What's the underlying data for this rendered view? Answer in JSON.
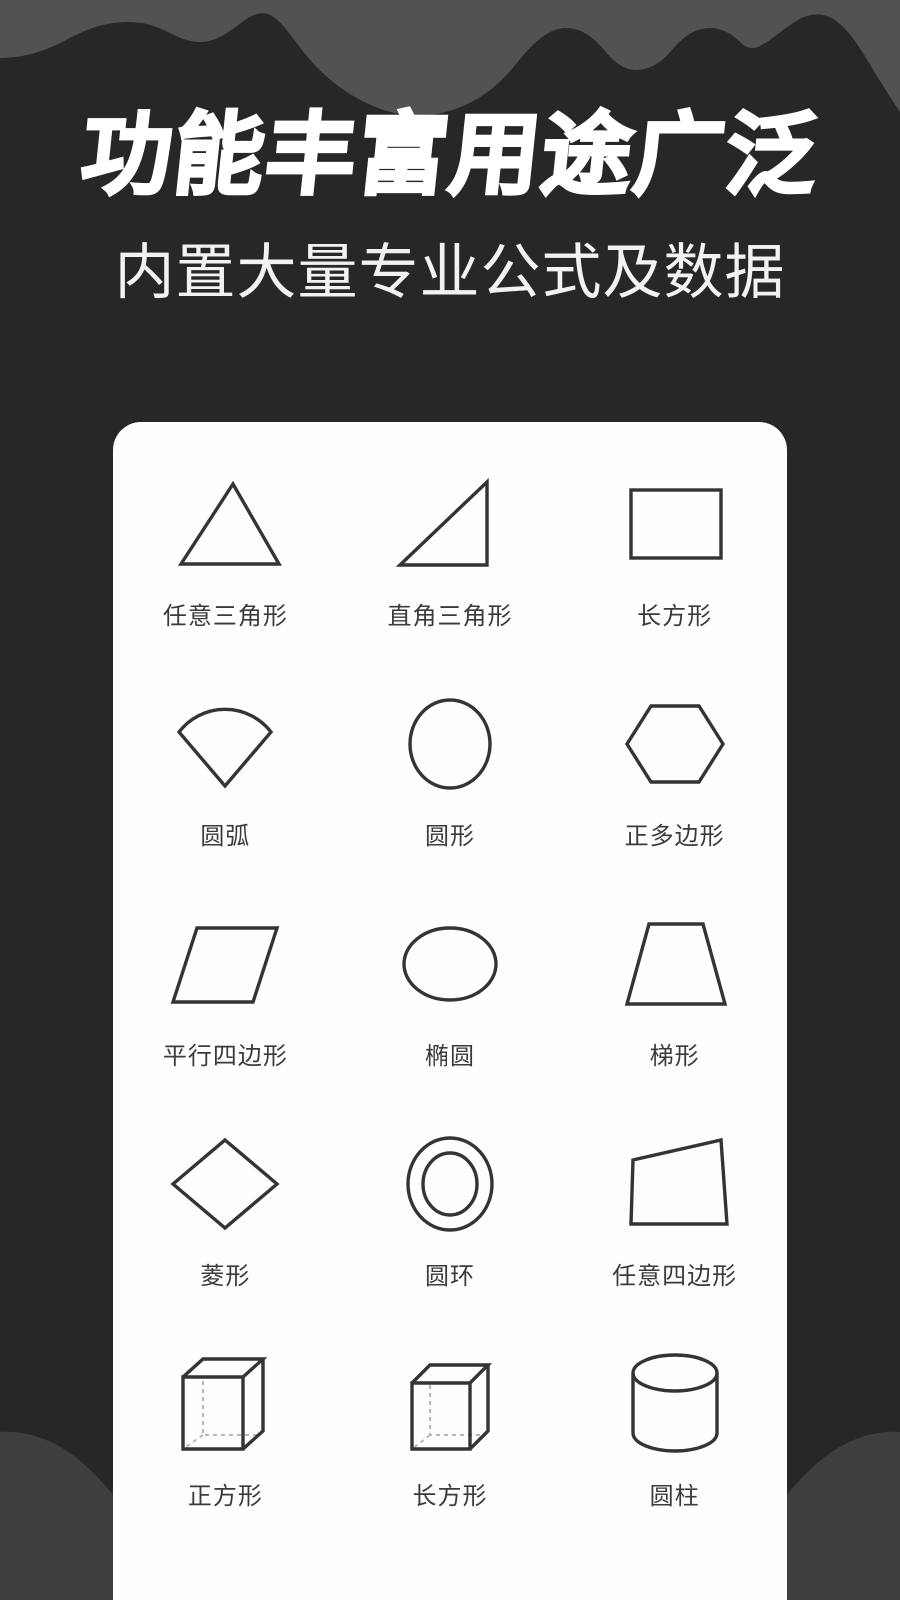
{
  "page": {
    "background_color": "#272727",
    "wave_color": "#525252",
    "card_color": "#fefefe",
    "shape_stroke_color": "#343434",
    "label_color": "#3b3b3b"
  },
  "header": {
    "title": "功能丰富用途广泛",
    "subtitle": "内置大量专业公式及数据"
  },
  "shape_grid": {
    "rows": 5,
    "columns": 3,
    "items": [
      {
        "label": "任意三角形",
        "icon": "arbitrary-triangle-icon"
      },
      {
        "label": "直角三角形",
        "icon": "right-triangle-icon"
      },
      {
        "label": "长方形",
        "icon": "rectangle-icon"
      },
      {
        "label": "圆弧",
        "icon": "circular-sector-icon"
      },
      {
        "label": "圆形",
        "icon": "circle-icon"
      },
      {
        "label": "正多边形",
        "icon": "regular-polygon-icon"
      },
      {
        "label": "平行四边形",
        "icon": "parallelogram-icon"
      },
      {
        "label": "椭圆",
        "icon": "ellipse-icon"
      },
      {
        "label": "梯形",
        "icon": "trapezoid-icon"
      },
      {
        "label": "菱形",
        "icon": "rhombus-icon"
      },
      {
        "label": "圆环",
        "icon": "annulus-icon"
      },
      {
        "label": "任意四边形",
        "icon": "arbitrary-quadrilateral-icon"
      },
      {
        "label": "正方形",
        "icon": "cube-icon"
      },
      {
        "label": "长方形",
        "icon": "cuboid-icon"
      },
      {
        "label": "圆柱",
        "icon": "cylinder-icon"
      }
    ]
  }
}
